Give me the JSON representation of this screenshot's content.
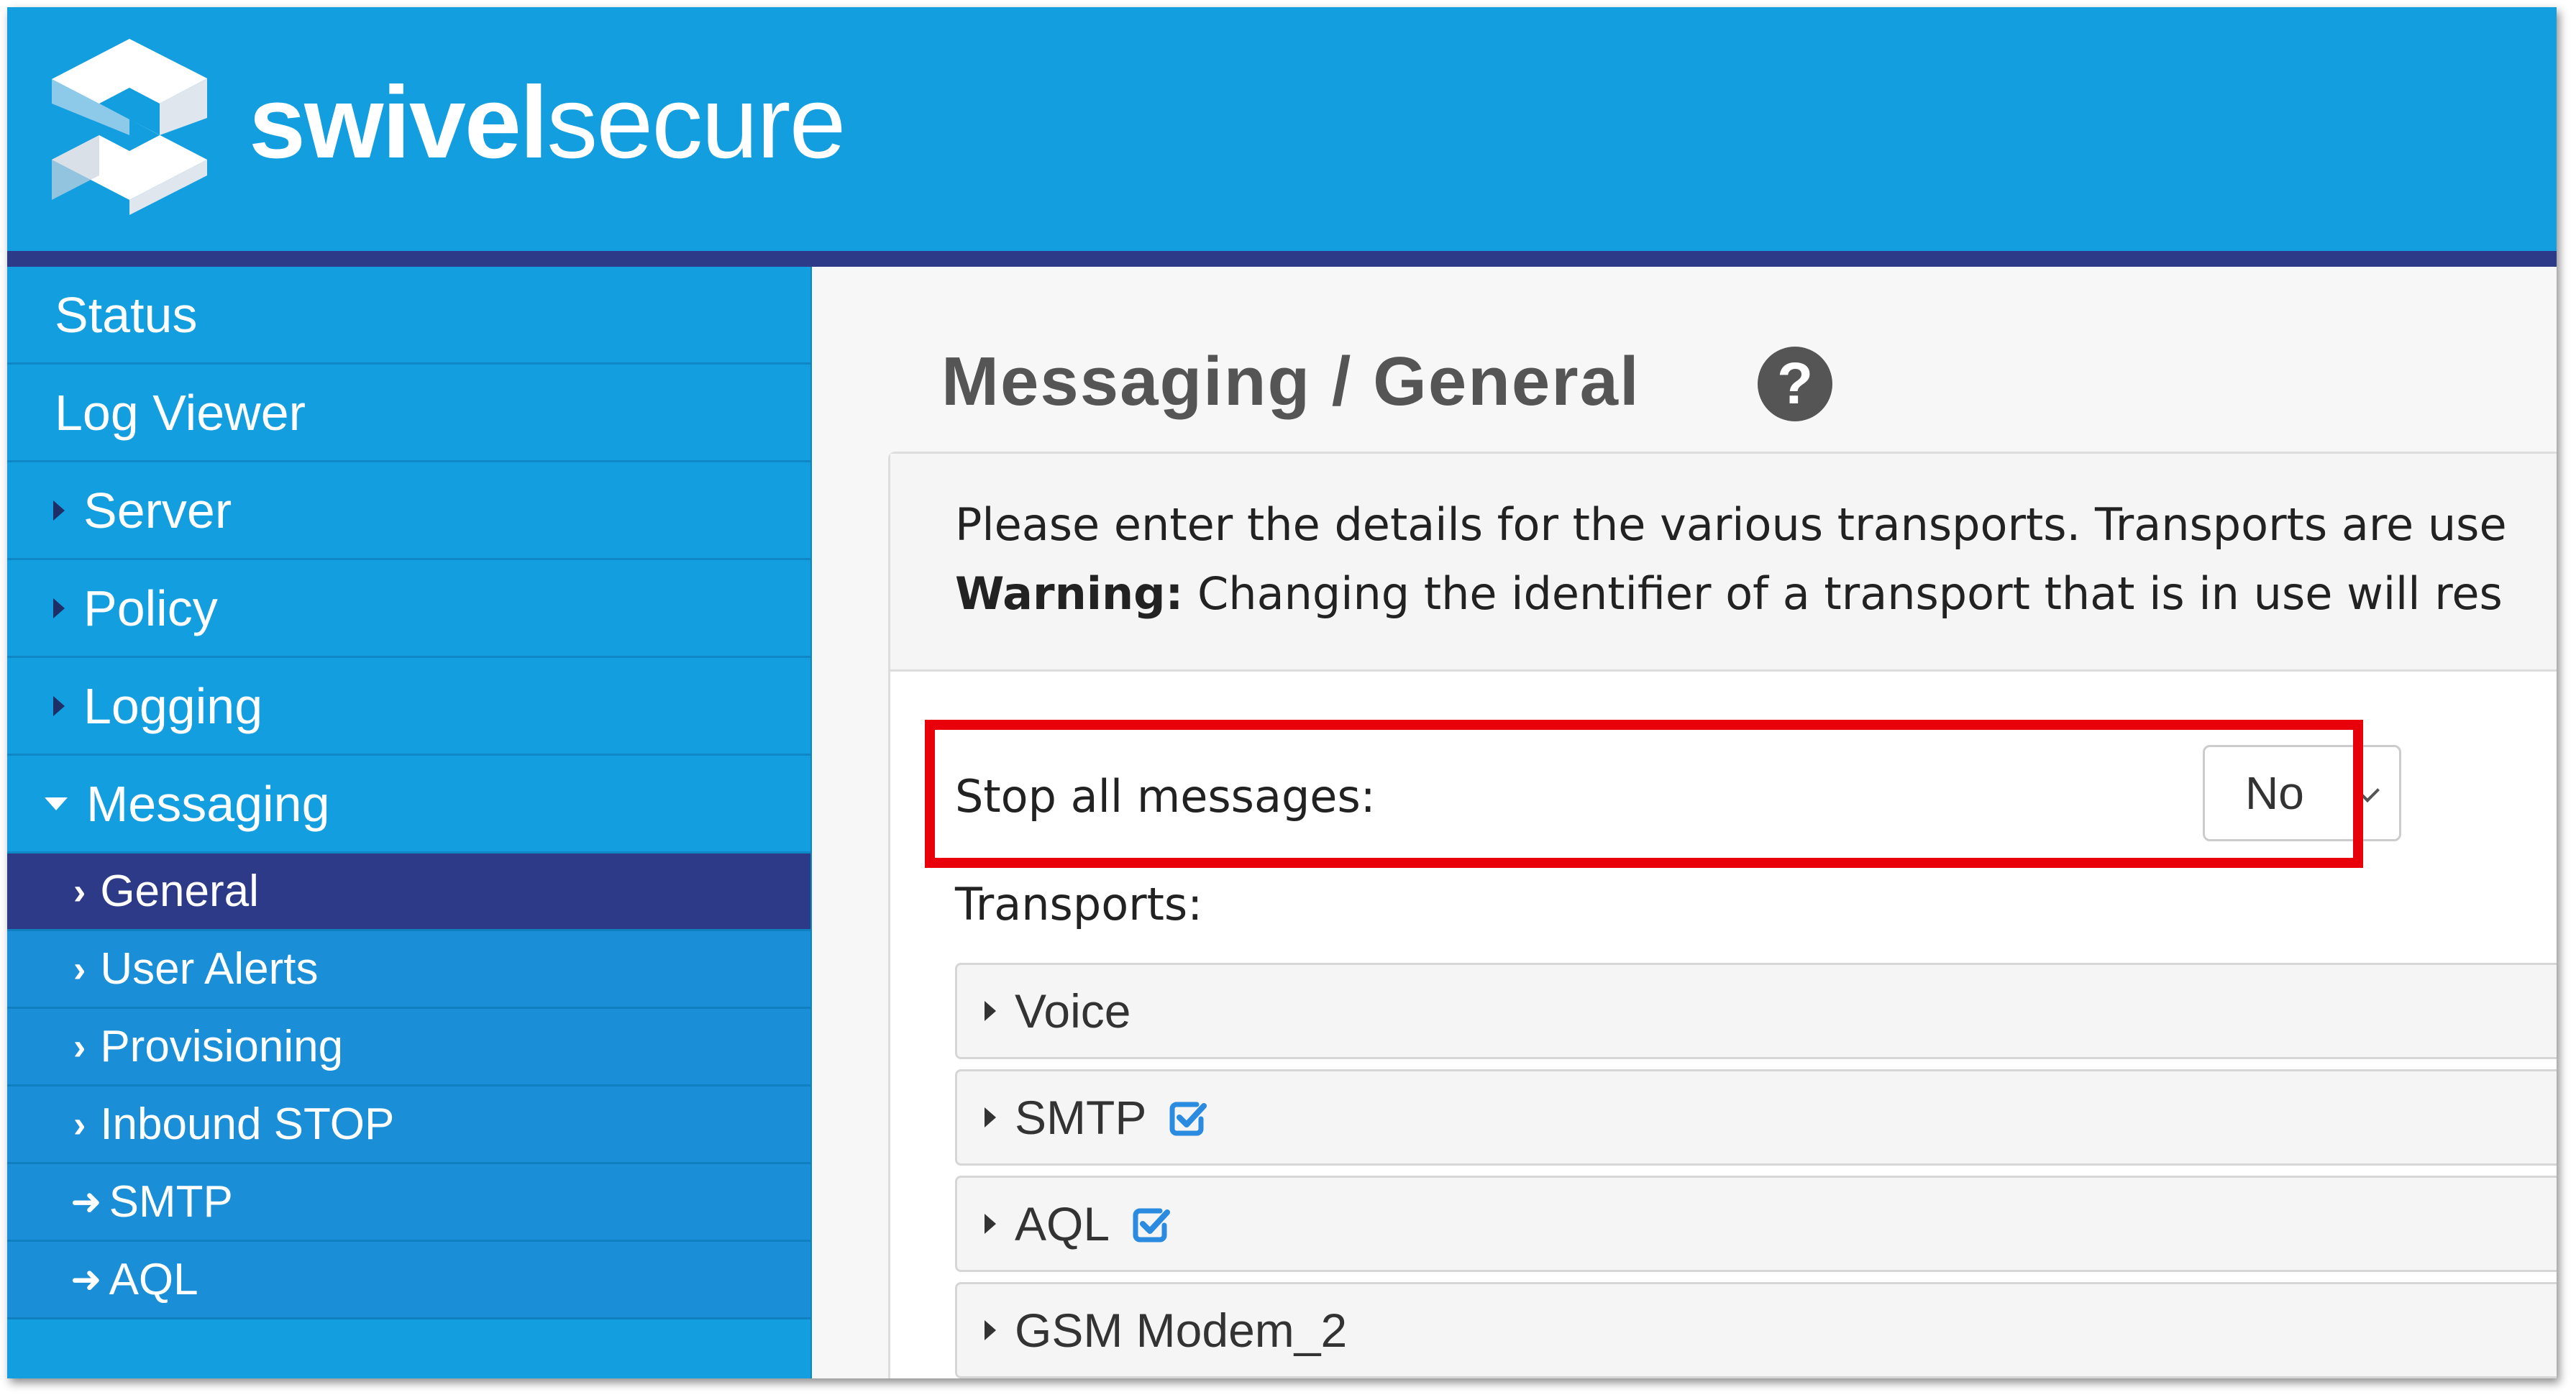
{
  "header": {
    "brand_bold": "swivel",
    "brand_light": "secure"
  },
  "sidebar": {
    "items": [
      {
        "label": "Status"
      },
      {
        "label": "Log Viewer"
      },
      {
        "label": "Server"
      },
      {
        "label": "Policy"
      },
      {
        "label": "Logging"
      },
      {
        "label": "Messaging"
      }
    ],
    "sub_items": [
      {
        "label": "General",
        "active": true
      },
      {
        "label": "User Alerts"
      },
      {
        "label": "Provisioning"
      },
      {
        "label": "Inbound STOP"
      },
      {
        "label": "SMTP"
      },
      {
        "label": "AQL"
      }
    ]
  },
  "main": {
    "title": "Messaging / General",
    "intro_line1": "Please enter the details for the various transports. Transports are use",
    "intro_warning": "Warning:",
    "intro_line2": " Changing the identifier of a transport that is in use will res",
    "stop_label": "Stop all messages:",
    "stop_value": "No",
    "transports_label": "Transports:",
    "transports": [
      {
        "label": "Voice",
        "enabled": false
      },
      {
        "label": "SMTP",
        "enabled": true
      },
      {
        "label": "AQL",
        "enabled": true
      },
      {
        "label": "GSM Modem_2",
        "enabled": false
      }
    ]
  },
  "colors": {
    "brand_blue": "#139ee0",
    "nav_dark": "#2d3a88",
    "highlight_red": "#e8000b",
    "check_blue": "#2a8be0"
  }
}
